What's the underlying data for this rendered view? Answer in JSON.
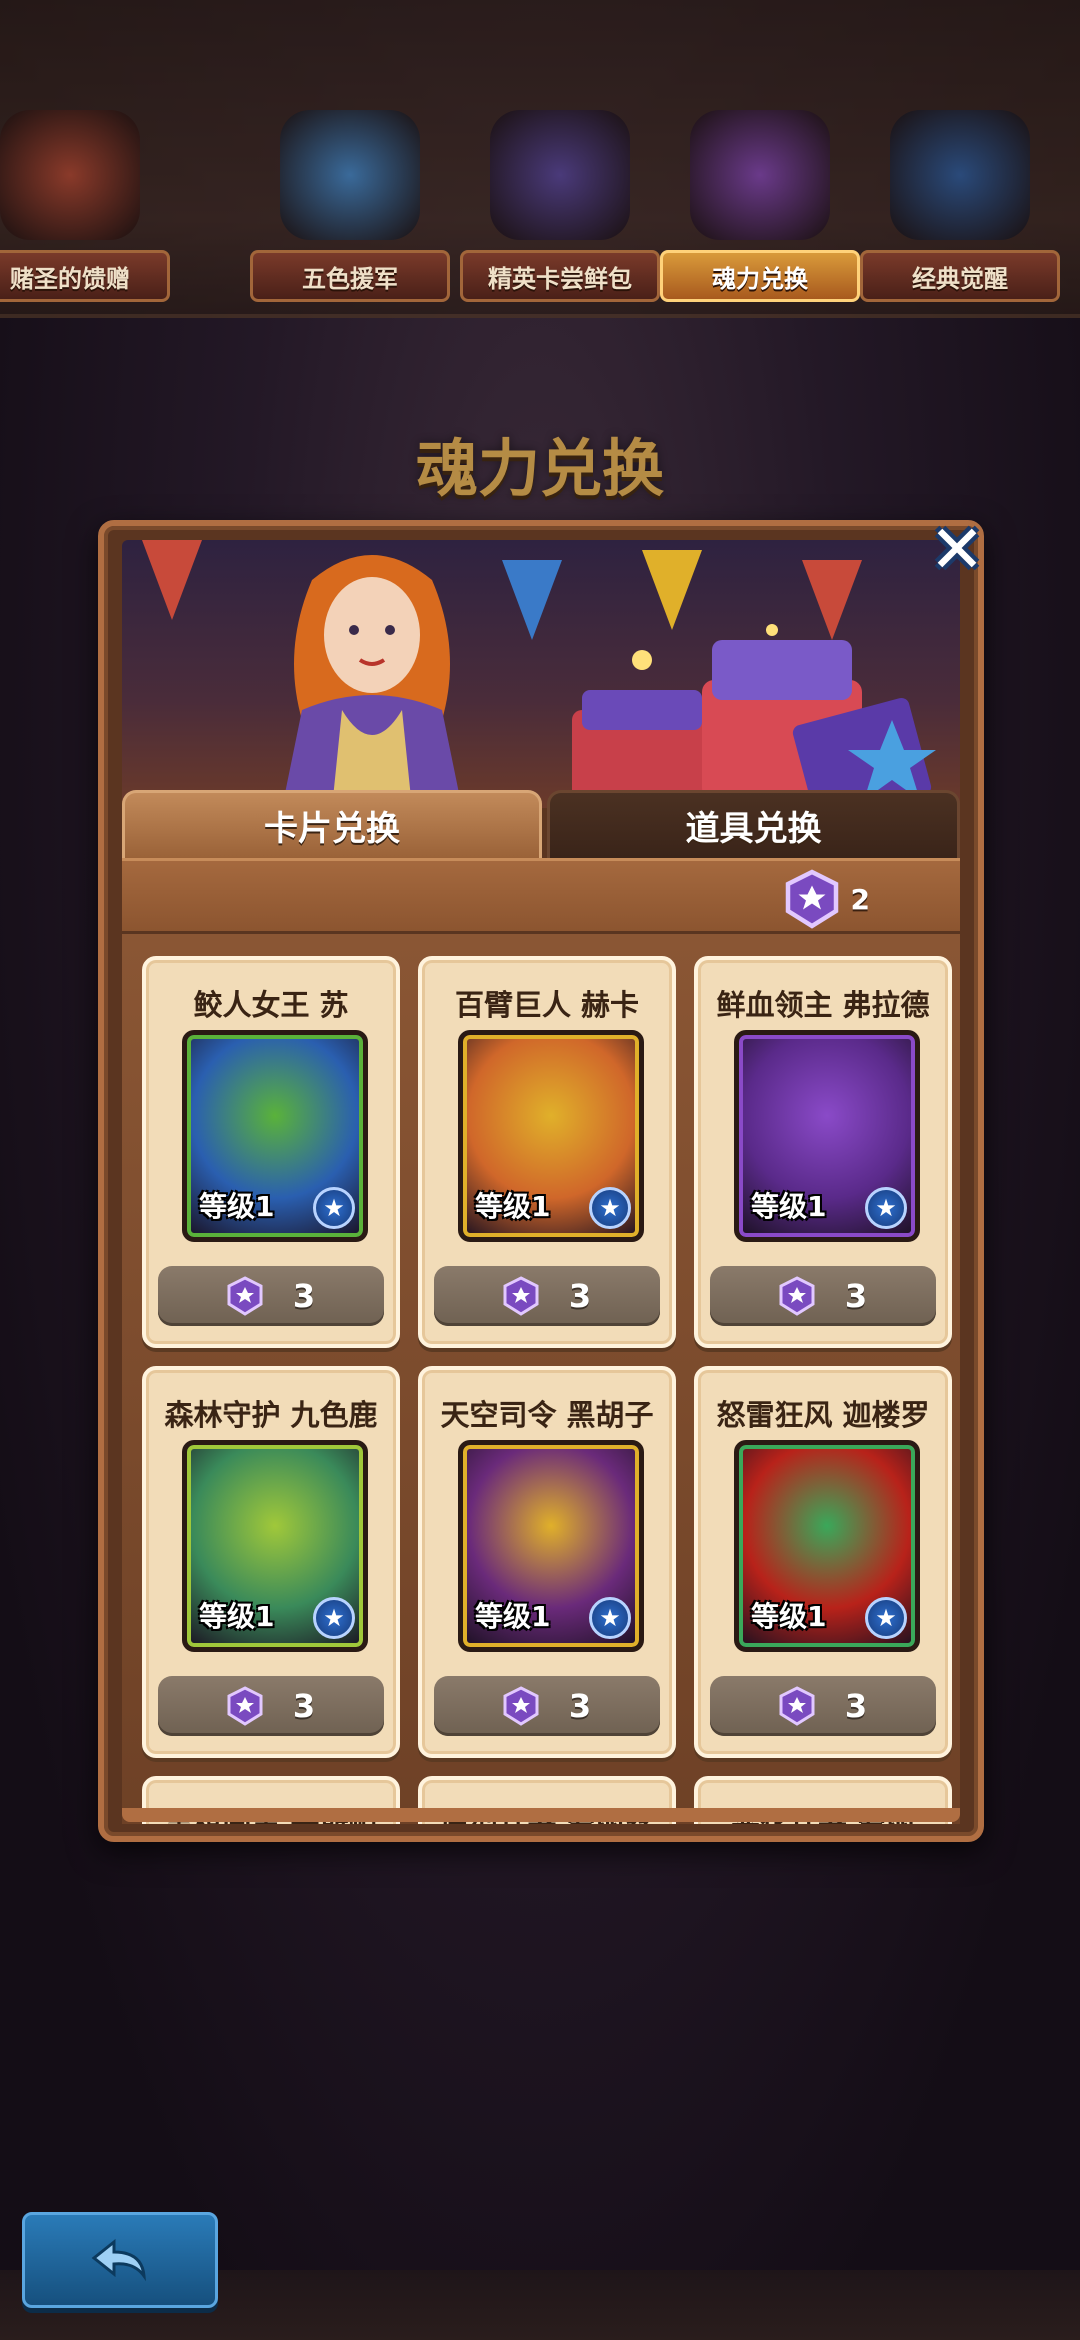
{
  "events": [
    {
      "label": "赌圣的馈赠",
      "active": false,
      "color": "#8a3a2a"
    },
    {
      "label": "五色援军",
      "active": false,
      "color": "#3a6a9a"
    },
    {
      "label": "精英卡尝鲜包",
      "active": false,
      "color": "#4a3a7a"
    },
    {
      "label": "魂力兑换",
      "active": true,
      "color": "#6a3a8a"
    },
    {
      "label": "经典觉醒",
      "active": false,
      "color": "#2a4a7a"
    }
  ],
  "page_title": "魂力兑换",
  "close_icon": "close-icon",
  "tabs": {
    "card_exchange": "卡片兑换",
    "item_exchange": "道具兑换"
  },
  "currency": {
    "icon": "soul-gem-icon",
    "amount": "2"
  },
  "cards": [
    {
      "name": "鲛人女王 苏",
      "level": "等级1",
      "price": "3",
      "art": "#2a5fb0",
      "accent": "#5ab23a"
    },
    {
      "name": "百臂巨人 赫卡",
      "level": "等级1",
      "price": "3",
      "art": "#d0672a",
      "accent": "#e0b02a"
    },
    {
      "name": "鲜血领主 弗拉德",
      "level": "等级1",
      "price": "3",
      "art": "#5a2a8a",
      "accent": "#8a4ac8"
    },
    {
      "name": "森林守护 九色鹿",
      "level": "等级1",
      "price": "3",
      "art": "#3a8a5a",
      "accent": "#a0c83a"
    },
    {
      "name": "天空司令 黑胡子",
      "level": "等级1",
      "price": "3",
      "art": "#6a2a7a",
      "accent": "#e0b02a"
    },
    {
      "name": "怒雷狂风 迦楼罗",
      "level": "等级1",
      "price": "3",
      "art": "#b8221a",
      "accent": "#3aa85a"
    },
    {
      "name": "黑棋国王 卡斯帕",
      "level": "",
      "price": "",
      "art": "#3a3a5a",
      "accent": "#8a8a8a"
    },
    {
      "name": "原型兵器 爱丽丝",
      "level": "",
      "price": "",
      "art": "#3a3a5a",
      "accent": "#8a8a8a"
    },
    {
      "name": "恶化兵器 爱丽",
      "level": "",
      "price": "",
      "art": "#3a3a5a",
      "accent": "#8a8a8a"
    }
  ],
  "back_button_icon": "back-arrow-icon"
}
